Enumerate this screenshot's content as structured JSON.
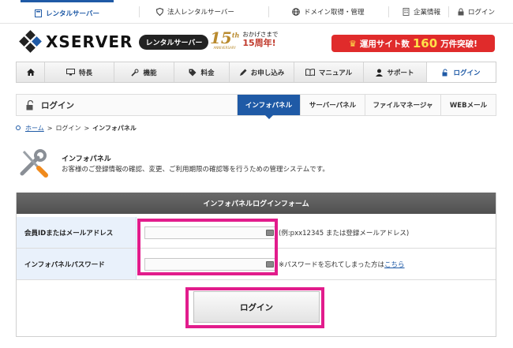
{
  "topbar": {
    "tabs": [
      {
        "label": "レンタルサーバー",
        "icon": "server-icon",
        "active": true
      },
      {
        "label": "法人レンタルサーバー",
        "icon": "shield-icon",
        "active": false
      },
      {
        "label": "ドメイン取得・管理",
        "icon": "globe-icon",
        "active": false
      },
      {
        "label": "企業情報",
        "icon": "building-icon",
        "active": false
      },
      {
        "label": "ログイン",
        "icon": "lock-icon",
        "active": false
      }
    ]
  },
  "header": {
    "logo": "XSERVER",
    "product_pill": "レンタルサーバー",
    "anniversary": {
      "number": "15",
      "suffix": "th",
      "sub": "ANNIVERSARY",
      "line1": "おかげさまで",
      "line2": "15周年!"
    },
    "banner": {
      "prefix": "運用サイト数",
      "number": "160",
      "suffix": "万件突破!"
    }
  },
  "mainnav": {
    "items": [
      {
        "label": "",
        "icon": "home-icon"
      },
      {
        "label": "特長",
        "icon": "monitor-icon"
      },
      {
        "label": "機能",
        "icon": "tools-icon"
      },
      {
        "label": "料金",
        "icon": "tag-icon"
      },
      {
        "label": "お申し込み",
        "icon": "pencil-icon"
      },
      {
        "label": "マニュアル",
        "icon": "book-icon"
      },
      {
        "label": "サポート",
        "icon": "person-icon"
      },
      {
        "label": "ログイン",
        "icon": "unlock-icon",
        "active": true
      }
    ]
  },
  "subnav": {
    "title": "ログイン",
    "tabs": [
      {
        "label": "インフォパネル",
        "active": true
      },
      {
        "label": "サーバーパネル",
        "active": false
      },
      {
        "label": "ファイルマネージャ",
        "active": false
      },
      {
        "label": "WEBメール",
        "active": false
      }
    ]
  },
  "breadcrumb": {
    "home": "ホーム",
    "login": "ログイン",
    "current": "インフォパネル"
  },
  "intro": {
    "heading": "インフォパネル",
    "description": "お客様のご登録情報の確認、変更、ご利用期限の確認等を行うための管理システムです。"
  },
  "form": {
    "title": "インフォパネルログインフォーム",
    "id_label": "会員IDまたはメールアドレス",
    "id_value": "",
    "id_hint": "(例:pxx12345 または登録メールアドレス)",
    "password_label": "インフォパネルパスワード",
    "password_value": "",
    "password_hint": "※パスワードを忘れてしまった方は",
    "password_link": "こちら",
    "submit_label": "ログイン"
  },
  "colors": {
    "accent": "#1f5aa6",
    "highlight": "#e21c8c",
    "banner": "#e02b2b"
  }
}
